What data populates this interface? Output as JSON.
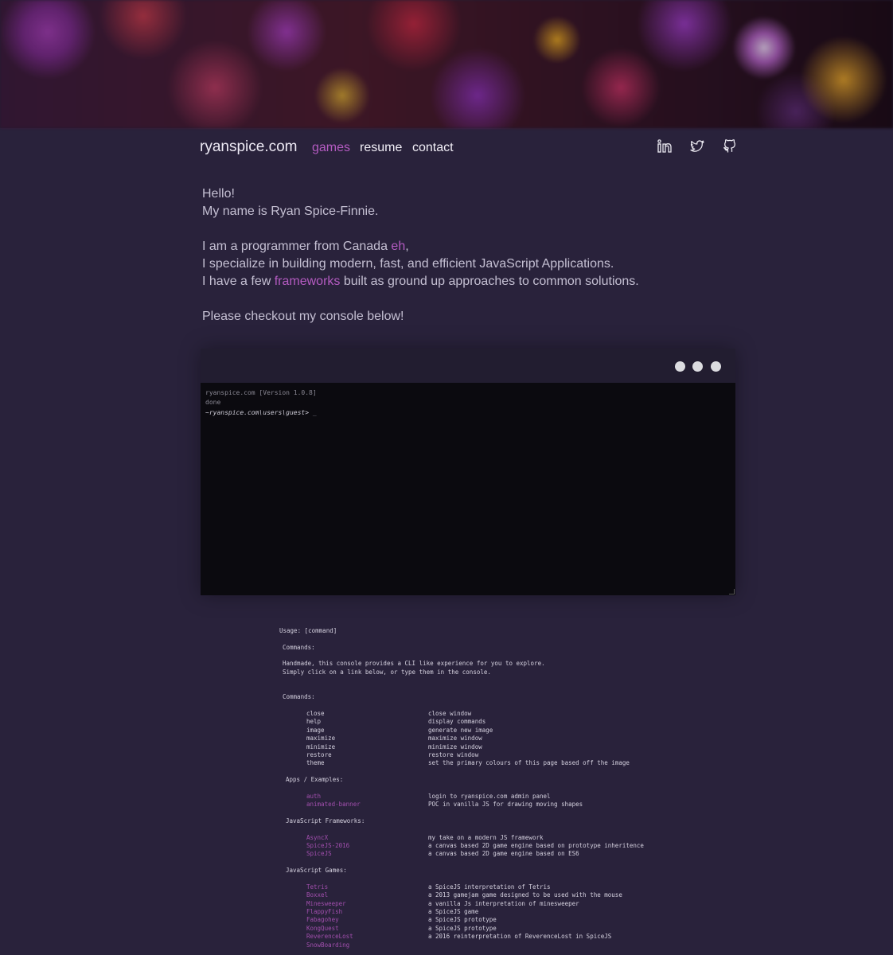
{
  "nav": {
    "brand": "ryanspice.com",
    "links": [
      {
        "label": "games",
        "active": true
      },
      {
        "label": "resume",
        "active": false
      },
      {
        "label": "contact",
        "active": false
      }
    ],
    "social_icons": [
      "linkedin-icon",
      "twitter-icon",
      "github-icon"
    ]
  },
  "intro": {
    "line1": "Hello!",
    "line2": "My name is Ryan Spice-Finnie.",
    "line3_pre": "I am a programmer from Canada ",
    "line3_link": "eh",
    "line3_post": ",",
    "line4": "I specialize in building modern, fast, and efficient JavaScript Applications.",
    "line5_pre": "I have a few ",
    "line5_link": "frameworks",
    "line5_post": " built as ground up approaches to common solutions.",
    "line6": "Please checkout my console below!"
  },
  "console": {
    "version": "ryanspice.com [Version 1.0.8]",
    "status": "done",
    "prompt": "~ryanspice.com\\users\\guest>",
    "cursor": "_"
  },
  "help": {
    "usage": "Usage: [command]",
    "commands_header": "Commands:",
    "desc1": "Handmade, this console provides a CLI like experience for you to explore.",
    "desc2": "Simply click on a link below, or type them in the console.",
    "commands_header2": "Commands:",
    "commands": [
      {
        "name": "close",
        "desc": "close window"
      },
      {
        "name": "help",
        "desc": "display commands"
      },
      {
        "name": "image",
        "desc": "generate new image"
      },
      {
        "name": "maximize",
        "desc": "maximize window"
      },
      {
        "name": "minimize",
        "desc": "minimize window"
      },
      {
        "name": "restore",
        "desc": "restore window"
      },
      {
        "name": "theme",
        "desc": "set the primary colours of this page based off the image"
      }
    ],
    "apps_header": "Apps / Examples:",
    "apps": [
      {
        "name": "auth",
        "desc": "login to ryanspice.com admin panel"
      },
      {
        "name": "animated-banner",
        "desc": "POC in vanilla JS for drawing moving shapes"
      }
    ],
    "frameworks_header": "JavaScript Frameworks:",
    "frameworks": [
      {
        "name": "AsyncX",
        "desc": "my take on a modern JS framework"
      },
      {
        "name": "SpiceJS-2016",
        "desc": "a canvas based 2D game engine based on prototype inheritence"
      },
      {
        "name": "SpiceJS",
        "desc": "a canvas based 2D game engine based on ES6"
      }
    ],
    "games_header": "JavaScript Games:",
    "games": [
      {
        "name": "Tetris",
        "desc": "a SpiceJS interpretation of Tetris"
      },
      {
        "name": "Boxxel",
        "desc": "a 2013 gamejam game designed to be used with the mouse"
      },
      {
        "name": "Minesweeper",
        "desc": "a vanilla Js interpretation of minesweeper"
      },
      {
        "name": "FlappyFish",
        "desc": "a SpiceJS game"
      },
      {
        "name": "Fabagohey",
        "desc": "a SpiceJS prototype"
      },
      {
        "name": "KongQuest",
        "desc": "a SpiceJS prototype"
      },
      {
        "name": "ReverenceLost",
        "desc": "a 2016 reinterpretation of ReverenceLost in SpiceJS"
      },
      {
        "name": "SnowBoarding",
        "desc": ""
      }
    ]
  },
  "colors": {
    "background": "#29223b",
    "accent": "#b45bc1",
    "console_bg": "#0b0a0f"
  }
}
